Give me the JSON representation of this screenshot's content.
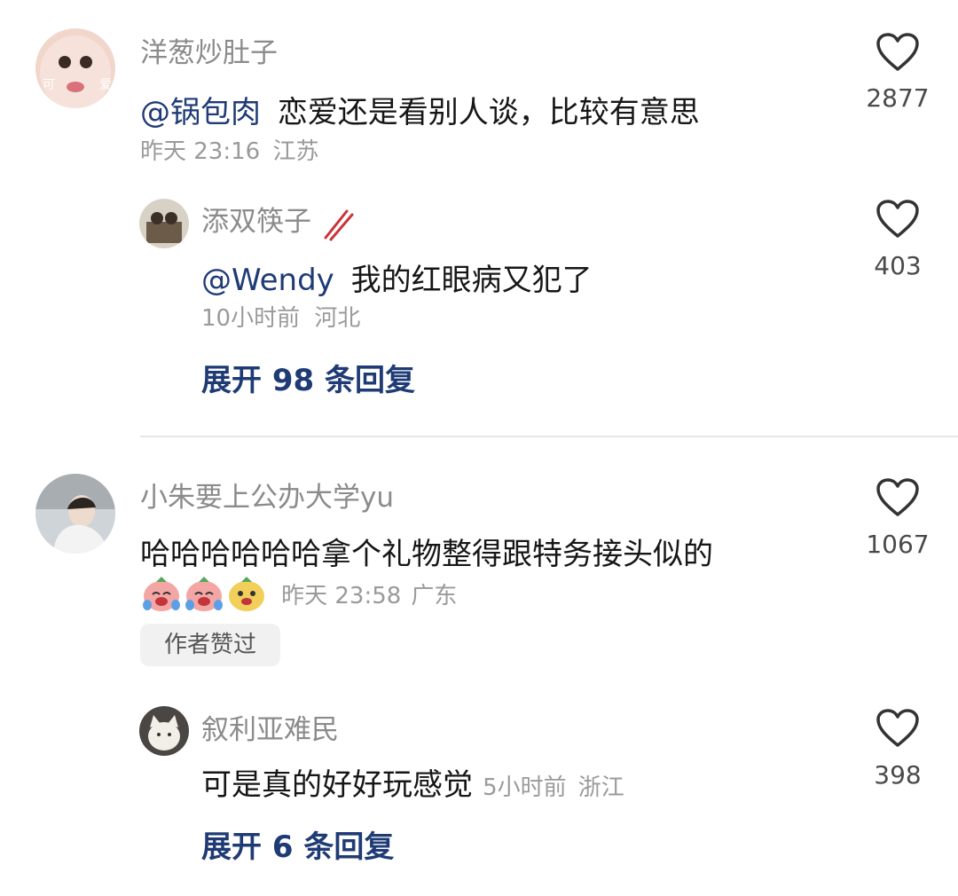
{
  "comments": [
    {
      "user": "洋葱炒肚子",
      "mention": "@锅包肉",
      "text": "恋爱还是看别人谈，比较有意思",
      "time": "昨天 23:16",
      "location": "江苏",
      "likes": "2877",
      "avatar_text_left": "可",
      "avatar_text_right": "爱",
      "reply": {
        "user": "添双筷子",
        "mention": "@Wendy",
        "text": "我的红眼病又犯了",
        "time": "10小时前",
        "location": "河北",
        "likes": "403"
      },
      "expand_label": "展开 98 条回复"
    },
    {
      "user": "小朱要上公办大学yu",
      "text": "哈哈哈哈哈哈拿个礼物整得跟特务接头似的",
      "time": "昨天 23:58",
      "location": "广东",
      "likes": "1067",
      "badge": "作者赞过",
      "reply": {
        "user": "叙利亚难民",
        "text": "可是真的好好玩感觉",
        "time": "5小时前",
        "location": "浙江",
        "likes": "398"
      },
      "expand_label": "展开 6 条回复"
    }
  ],
  "colors": {
    "mention": "#1f3b75",
    "expand": "#1f3b75",
    "meta": "#9a9a9a"
  }
}
